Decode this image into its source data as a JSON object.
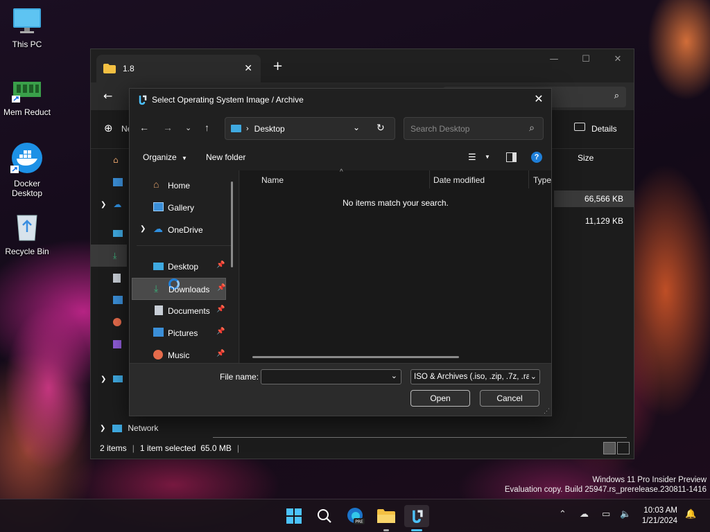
{
  "desktop": {
    "icons": [
      {
        "label": "This PC"
      },
      {
        "label": "Mem Reduct"
      },
      {
        "label": "Docker\nDesktop"
      },
      {
        "label": "Recycle Bin"
      }
    ],
    "watermark_line1": "Windows 11 Pro Insider Preview",
    "watermark_line2": "Evaluation copy. Build 25947.rs_prerelease.230811-1416"
  },
  "explorer": {
    "tab_title": "1.8",
    "toolbar_new": "Ne",
    "details_label": "Details",
    "size_header": "Size",
    "sizes": [
      "66,566 KB",
      "11,129 KB"
    ],
    "network_label": "Network",
    "status_items": "2 items",
    "status_selected": "1 item selected  65.0 MB"
  },
  "dialog": {
    "title": "Select Operating System Image / Archive",
    "address_location": "Desktop",
    "search_placeholder": "Search Desktop",
    "organize_label": "Organize",
    "new_folder_label": "New folder",
    "tree": [
      {
        "label": "Home",
        "icon": "home-icon"
      },
      {
        "label": "Gallery",
        "icon": "gallery-icon"
      },
      {
        "label": "OneDrive",
        "icon": "onedrive-icon"
      },
      {
        "label": "Desktop",
        "icon": "desktop-icon"
      },
      {
        "label": "Downloads",
        "icon": "download-icon"
      },
      {
        "label": "Documents",
        "icon": "documents-icon"
      },
      {
        "label": "Pictures",
        "icon": "pictures-icon"
      },
      {
        "label": "Music",
        "icon": "music-icon"
      }
    ],
    "columns": {
      "name": "Name",
      "date": "Date modified",
      "type": "Type"
    },
    "empty_message": "No items match your search.",
    "file_name_label": "File name:",
    "file_name_value": "",
    "filter_value": "ISO & Archives (.iso, .zip, .7z, .ra",
    "open_label": "Open",
    "cancel_label": "Cancel"
  },
  "taskbar": {
    "time": "10:03 AM",
    "date": "1/21/2024"
  },
  "colors": {
    "accent": "#4cc2ff",
    "dialog_bg": "#202020",
    "selection_bg": "#4a4a4a"
  }
}
